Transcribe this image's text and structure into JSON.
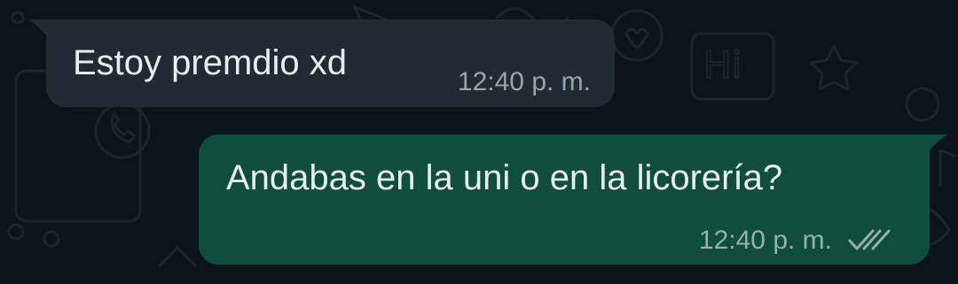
{
  "messages": [
    {
      "direction": "incoming",
      "text": "Estoy premdio xd",
      "time": "12:40 p. m."
    },
    {
      "direction": "outgoing",
      "text": "Andabas en la uni o en la licorería?",
      "time": "12:40 p. m.",
      "status_icon": "double-check-icon"
    }
  ],
  "colors": {
    "background": "#0b141a",
    "incoming_bubble": "#202c33",
    "outgoing_bubble": "#0f4d3c",
    "text": "#e9edef"
  }
}
